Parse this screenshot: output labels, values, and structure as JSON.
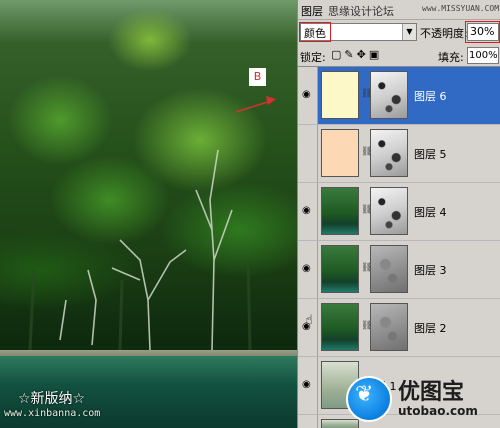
{
  "photo": {
    "callout_label": "B",
    "watermark_text": "☆新版纳☆",
    "watermark_url": "www.xinbanna.com"
  },
  "panel": {
    "title_tab": "图层",
    "site_name": "思缘设计论坛",
    "site_url": "www.MISSYUAN.COM"
  },
  "blend": {
    "mode": "颜色",
    "opacity_label": "不透明度:",
    "opacity_value": "30%"
  },
  "lock": {
    "label": "锁定:",
    "icons": [
      "transparency-lock-icon",
      "brush-lock-icon",
      "move-lock-icon",
      "all-lock-icon"
    ],
    "fill_label": "填充:",
    "fill_value": "100%"
  },
  "layers": [
    {
      "name": "图层 6",
      "visible": true,
      "selected": true,
      "thumb": "cream",
      "has_mask": true
    },
    {
      "name": "图层 5",
      "visible": false,
      "selected": false,
      "thumb": "peach",
      "has_mask": true
    },
    {
      "name": "图层 4",
      "visible": true,
      "selected": false,
      "thumb": "forest",
      "has_mask": true
    },
    {
      "name": "图层 3",
      "visible": true,
      "selected": false,
      "thumb": "forest",
      "has_mask": true
    },
    {
      "name": "图层 2",
      "visible": true,
      "selected": false,
      "thumb": "forest",
      "has_mask": true
    },
    {
      "name": "图层 1",
      "visible": true,
      "selected": false,
      "thumb": "pale",
      "has_mask": false
    }
  ],
  "watermark": {
    "brand": "优图宝",
    "url": "utobao.com"
  },
  "colors": {
    "selection": "#316ac5",
    "panel_bg": "#d6d3ce",
    "highlight_red": "#d02020"
  }
}
